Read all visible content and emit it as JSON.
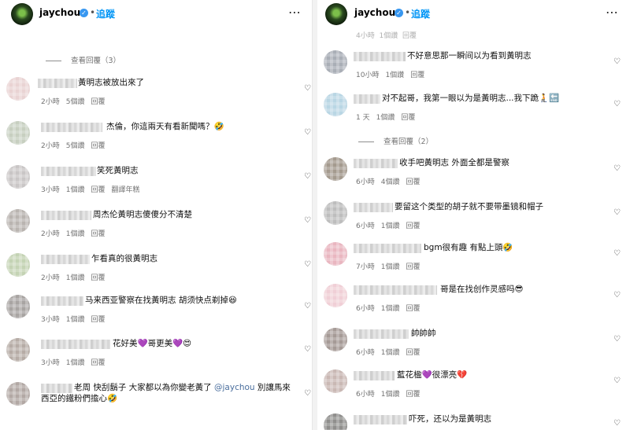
{
  "left": {
    "header": {
      "username": "jaychou",
      "follow": "追蹤"
    },
    "view_replies": "查看回覆（3）",
    "comments": [
      {
        "text": "黃明志被放出來了",
        "time": "2小時",
        "likes": "5個讚",
        "reply": "回覆",
        "extra": ""
      },
      {
        "text": "杰倫，你這兩天有看新聞嗎？🤣",
        "time": "2小時",
        "likes": "5個讚",
        "reply": "回覆",
        "extra": ""
      },
      {
        "text": "笑死黃明志",
        "time": "3小時",
        "likes": "1個讚",
        "reply": "回覆",
        "extra": "翻譯年糕"
      },
      {
        "text": "周杰伦黃明志傻傻分不清楚",
        "time": "2小時",
        "likes": "1個讚",
        "reply": "回覆",
        "extra": ""
      },
      {
        "text": "乍看真的很黃明志",
        "time": "2小時",
        "likes": "1個讚",
        "reply": "回覆",
        "extra": ""
      },
      {
        "text": "马来西亚警察在找黃明志 胡须快点剃掉😆",
        "time": "3小時",
        "likes": "1個讚",
        "reply": "回覆",
        "extra": ""
      },
      {
        "text": "花好美💜哥更美💜😍",
        "time": "3小時",
        "likes": "1個讚",
        "reply": "回覆",
        "extra": ""
      },
      {
        "text_pre": "老周 快刮鬍子 大家都以為你變老黃了 ",
        "mention": "@jaychou",
        "text_post": " 別讓馬來西亞的鐵粉們擔心🤣",
        "time": "",
        "likes": "",
        "reply": "",
        "extra": ""
      }
    ]
  },
  "right": {
    "header": {
      "username": "jaychou",
      "follow": "追蹤"
    },
    "top_meta": {
      "time": "4小時",
      "likes": "1個讚",
      "reply": "回覆"
    },
    "view_replies": "查看回覆（2）",
    "comments": [
      {
        "text": "不好意思那一瞬间以为看到黃明志",
        "time": "10小時",
        "likes": "1個讚",
        "reply": "回覆"
      },
      {
        "text": "对不起哥，我第一眼以为是黃明志...我下跪🧎🔚",
        "time": "1 天",
        "likes": "1個讚",
        "reply": "回覆"
      },
      {
        "text": "收手吧黃明志 外面全都是警察",
        "time": "6小時",
        "likes": "4個讚",
        "reply": "回覆"
      },
      {
        "text": "要留这个类型的胡子就不要带墨镜和帽子",
        "time": "6小時",
        "likes": "1個讚",
        "reply": "回覆"
      },
      {
        "text": "bgm很有趣 有點上頭🤣",
        "time": "7小時",
        "likes": "1個讚",
        "reply": "回覆"
      },
      {
        "text": "哥是在找创作灵感吗😎",
        "time": "6小時",
        "likes": "1個讚",
        "reply": "回覆"
      },
      {
        "text": "帥帥帥",
        "time": "6小時",
        "likes": "1個讚",
        "reply": "回覆"
      },
      {
        "text": "藍花楹💜很漂亮💔",
        "time": "6小時",
        "likes": "1個讚",
        "reply": "回覆"
      },
      {
        "text": "吓死，还以为是黃明志",
        "time": "",
        "likes": "",
        "reply": ""
      }
    ]
  },
  "colors": {
    "follow": "#0095f6",
    "verified": "#3897f0",
    "meta": "#737373",
    "mention": "#4a6e9d"
  },
  "icons": {
    "verified": "check-badge",
    "more": "three-dots",
    "like": "heart-outline"
  }
}
